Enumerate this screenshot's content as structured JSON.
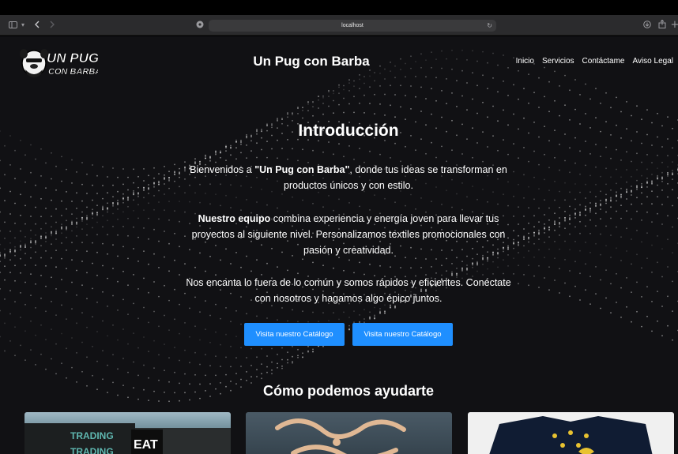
{
  "browser": {
    "url": "localhost"
  },
  "site": {
    "title": "Un Pug con Barba",
    "logo_text_1": "UN PUG",
    "logo_text_2": "CON BARBA",
    "nav": [
      "Inicio",
      "Servicios",
      "Contáctame",
      "Aviso Legal"
    ]
  },
  "intro": {
    "title": "Introducción",
    "p1_prefix": "Bienvenidos a ",
    "p1_bold": "\"Un Pug con Barba\"",
    "p1_suffix": ", donde tus ideas se transforman en productos únicos y con estilo.",
    "p2_bold": "Nuestro equipo",
    "p2_suffix": " combina experiencia y energía joven para llevar tus proyectos al siguiente nivel. Personalizamos textiles promocionales con pasión y creatividad.",
    "p3": "Nos encanta lo fuera de lo común y somos rápidos y eficientes. Conéctate con nosotros y hagamos algo épico juntos.",
    "buttons": [
      "Visita nuestro Catálogo",
      "Visita nuestro Catálogo"
    ]
  },
  "help": {
    "title": "Cómo podemos ayudarte",
    "card1_text_1": "TRADING",
    "card1_text_2": "TRADING",
    "card1_text_3": "EAT"
  },
  "colors": {
    "accent": "#1f8fff",
    "background": "#111114"
  }
}
